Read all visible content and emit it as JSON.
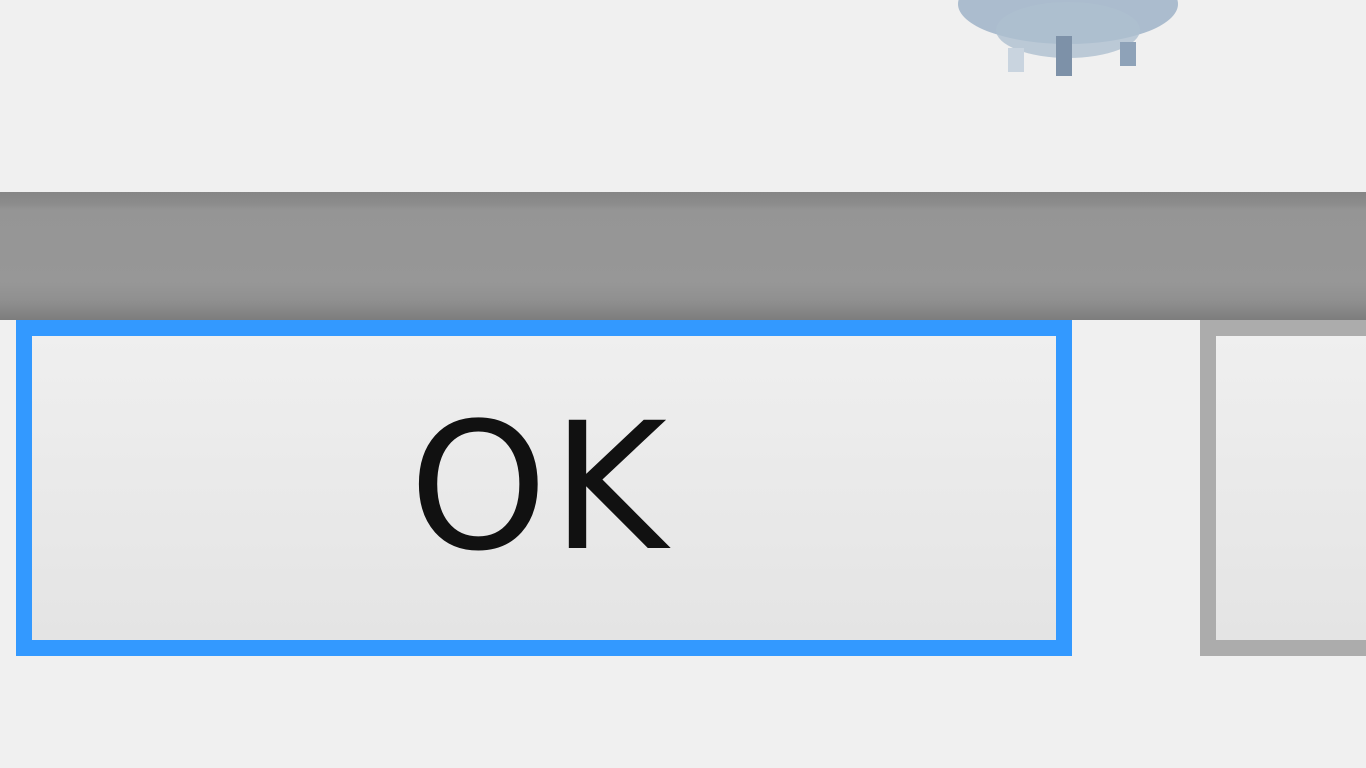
{
  "dialog": {
    "top_text_fragment": "",
    "buttons": {
      "ok_label": "OK",
      "cancel_label": ""
    }
  },
  "colors": {
    "focus_border": "#3399ff",
    "default_border": "#acacac",
    "bar": "#979797",
    "background": "#f0f0f0"
  },
  "icons": {
    "top_right": "info-icon"
  }
}
